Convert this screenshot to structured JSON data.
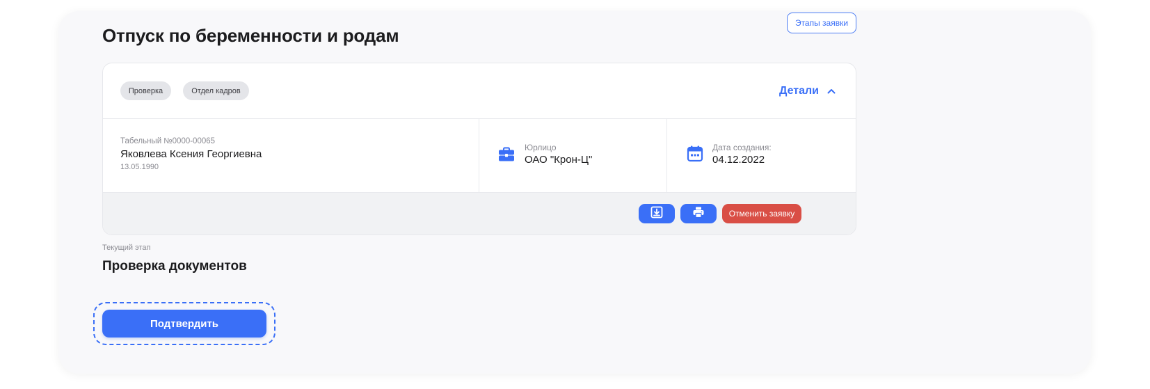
{
  "page": {
    "title": "Отпуск по беременности и родам",
    "stages_button_label": "Этапы заявки"
  },
  "card": {
    "tags": [
      "Проверка",
      "Отдел кадров"
    ],
    "details_label": "Детали",
    "employee": {
      "id_line": "Табельный №0000-00065",
      "name": "Яковлева Ксения Георгиевна",
      "birth_date": "13.05.1990"
    },
    "legal_entity": {
      "label": "Юрлицо",
      "value": "ОАО \"Крон-Ц\""
    },
    "created": {
      "label": "Дата создания:",
      "value": "04.12.2022"
    },
    "actions": {
      "cancel_label": "Отменить заявку"
    }
  },
  "current_stage": {
    "label": "Текущий этап",
    "value": "Проверка документов"
  },
  "confirm_label": "Подтвердить",
  "colors": {
    "accent": "#3a6ff7",
    "danger": "#d94e45",
    "tag_bg": "#e4e5e9",
    "page_bg": "#f8f8fa"
  },
  "icons": {
    "legal_entity": "briefcase-icon",
    "created": "calendar-icon",
    "download": "download-icon",
    "print": "printer-icon",
    "details_toggle": "chevron-up-icon"
  }
}
